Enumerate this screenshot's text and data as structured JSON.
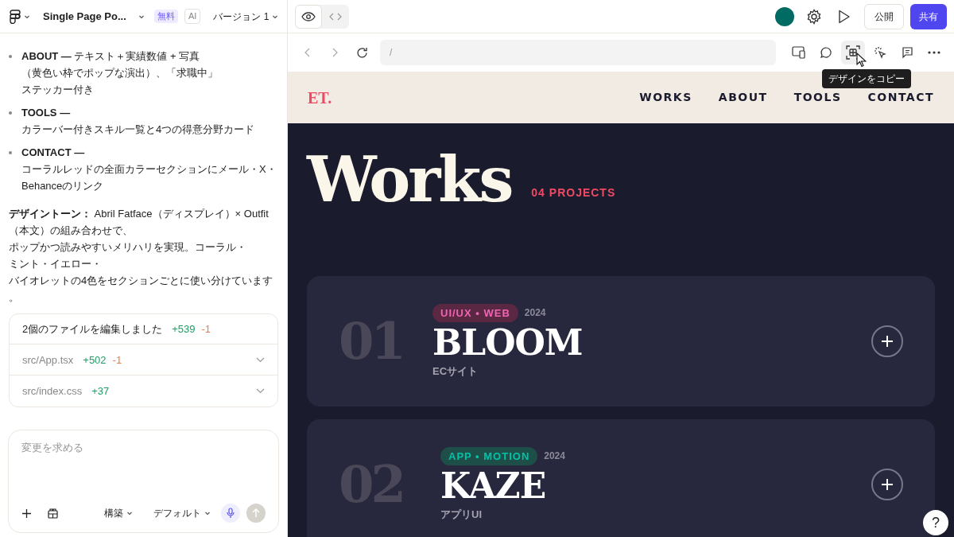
{
  "header": {
    "project_title": "Single Page Po...",
    "plan_badge": "無料",
    "ai_badge": "AI",
    "version": "バージョン 1"
  },
  "chat": {
    "bullets": [
      {
        "lines": [
          "**ABOUT —** テキスト＋実績数値 + 写真",
          "（黄色い枠でポップな演出）、「求職中」",
          "ステッカー付き"
        ]
      },
      {
        "lines": [
          "**TOOLS —**",
          "カラーバー付きスキル一覧と4つの得意分野カード"
        ]
      },
      {
        "lines": [
          "**CONTACT —**",
          "コーラルレッドの全面カラーセクションにメール・X・",
          "Behanceのリンク"
        ]
      }
    ],
    "paragraph": [
      "**デザイントーン：** Abril Fatface（ディスプレイ）× Outfit",
      "（本文）の組み合わせで、",
      "ポップかつ読みやすいメリハリを実現。コーラル・",
      "ミント・イエロー・",
      "バイオレットの4色をセクションごとに使い分けています",
      "。"
    ],
    "changes": {
      "summary": "2個のファイルを編集しました",
      "added": "+539",
      "removed": "-1",
      "files": [
        {
          "path": "src/App.tsx",
          "added": "+502",
          "removed": "-1"
        },
        {
          "path": "src/index.css",
          "added": "+37"
        }
      ]
    }
  },
  "composer": {
    "placeholder": "変更を求める",
    "mode": "構築",
    "model": "デフォルト"
  },
  "top_bar": {
    "view_tabs": [
      {
        "kind": "preview",
        "selected": true
      },
      {
        "kind": "code",
        "selected": false
      }
    ],
    "publish": "公開",
    "share": "共有"
  },
  "preview_bar": {
    "address": "/",
    "tooltip": "デザインをコピー"
  },
  "site": {
    "logo": "ET.",
    "nav": [
      "WORKS",
      "ABOUT",
      "TOOLS",
      "CONTACT"
    ],
    "heading": "Works",
    "count": "04 PROJECTS",
    "projects": [
      {
        "number": "01",
        "tag": "UI/UX • WEB",
        "color": "#5a2843",
        "year": "2024",
        "title": "BLOOM",
        "subtitle": "ECサイト"
      },
      {
        "number": "02",
        "tag": "APP • MOTION",
        "color": "#1d4e47",
        "year": "2024",
        "title": "KAZE",
        "subtitle": "アプリUI"
      }
    ]
  },
  "help": "?"
}
